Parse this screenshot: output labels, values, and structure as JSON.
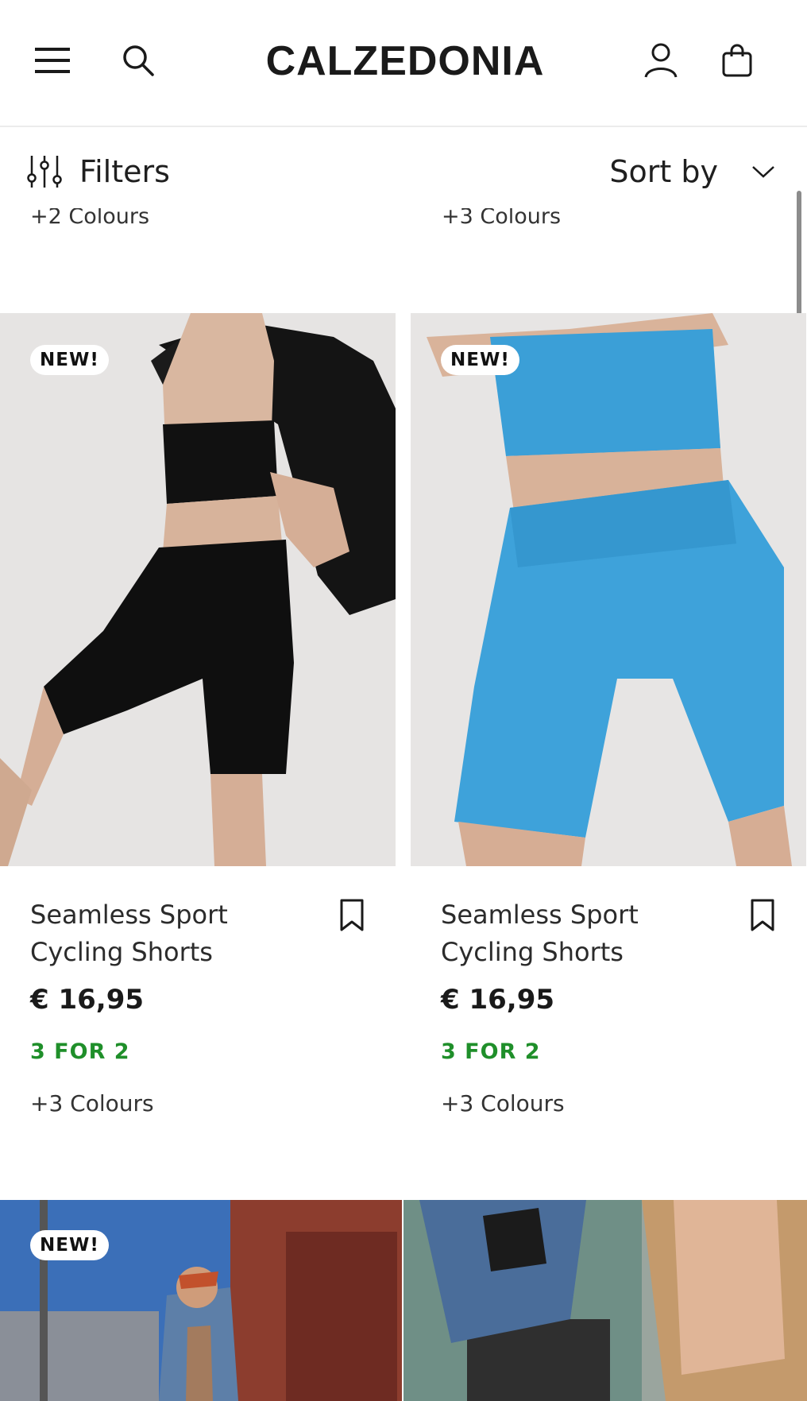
{
  "header": {
    "logo": "CALZEDONIA",
    "icons": [
      "hamburger-menu-icon",
      "search-icon",
      "account-icon",
      "shopping-bag-icon"
    ]
  },
  "toolbar": {
    "filters_label": "Filters",
    "sort_label": "Sort by"
  },
  "previous_row": {
    "left_colours": "+2 Colours",
    "right_colours": "+3 Colours"
  },
  "products": [
    {
      "badge": "NEW!",
      "name": "Seamless Sport Cycling Shorts",
      "price": "€ 16,95",
      "promo": "3 FOR 2",
      "colours": "+3 Colours",
      "color": "#111111"
    },
    {
      "badge": "NEW!",
      "name": "Seamless Sport Cycling Shorts",
      "price": "€ 16,95",
      "promo": "3 FOR 2",
      "colours": "+3 Colours",
      "color": "#3a9fd8"
    }
  ],
  "next_row": {
    "left_badge": "NEW!"
  },
  "colors": {
    "promo_green": "#1f8f2a",
    "text_dark": "#1a1a1a",
    "image_bg": "#e4e2e1"
  }
}
